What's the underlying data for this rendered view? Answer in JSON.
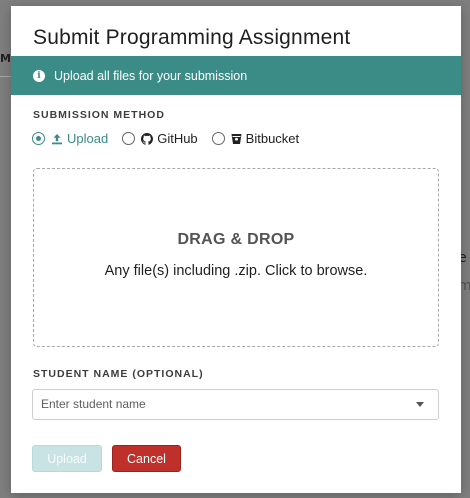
{
  "background": {
    "left_fragment": "ME",
    "right_fragment_1": "e",
    "right_fragment_2": "m"
  },
  "modal": {
    "title": "Submit Programming Assignment",
    "banner": {
      "icon": "info-icon",
      "text": "Upload all files for your submission",
      "color": "#3b8b86"
    },
    "submission_method": {
      "label": "SUBMISSION METHOD",
      "selected": "Upload",
      "options": [
        {
          "label": "Upload",
          "icon": "upload-icon",
          "checked": true
        },
        {
          "label": "GitHub",
          "icon": "github-icon",
          "checked": false
        },
        {
          "label": "Bitbucket",
          "icon": "bitbucket-icon",
          "checked": false
        }
      ]
    },
    "dropzone": {
      "title": "DRAG & DROP",
      "subtitle": "Any file(s) including .zip. Click to browse."
    },
    "student_name": {
      "label": "STUDENT NAME (OPTIONAL)",
      "placeholder": "Enter student name",
      "value": ""
    },
    "buttons": {
      "upload_label": "Upload",
      "cancel_label": "Cancel",
      "upload_disabled": true
    },
    "colors": {
      "accent": "#3b8b86",
      "danger": "#c0302b"
    }
  }
}
